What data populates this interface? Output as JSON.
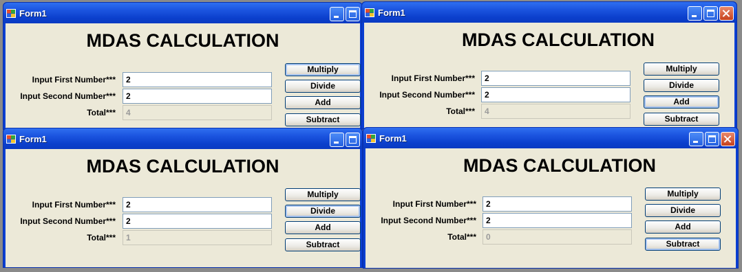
{
  "windows": [
    {
      "title": "Form1",
      "heading": "MDAS CALCULATION",
      "first_label": "Input First Number***",
      "second_label": "Input Second Number***",
      "total_label": "Total***",
      "first_value": "2",
      "second_value": "2",
      "total_value": "4",
      "focused_button": "multiply",
      "buttons": {
        "multiply": "Multiply",
        "divide": "Divide",
        "add": "Add",
        "subtract": "Subtract"
      }
    },
    {
      "title": "Form1",
      "heading": "MDAS CALCULATION",
      "first_label": "Input First Number***",
      "second_label": "Input Second Number***",
      "total_label": "Total***",
      "first_value": "2",
      "second_value": "2",
      "total_value": "4",
      "focused_button": "add",
      "buttons": {
        "multiply": "Multiply",
        "divide": "Divide",
        "add": "Add",
        "subtract": "Subtract"
      }
    },
    {
      "title": "Form1",
      "heading": "MDAS CALCULATION",
      "first_label": "Input First Number***",
      "second_label": "Input Second Number***",
      "total_label": "Total***",
      "first_value": "2",
      "second_value": "2",
      "total_value": "1",
      "focused_button": "divide",
      "buttons": {
        "multiply": "Multiply",
        "divide": "Divide",
        "add": "Add",
        "subtract": "Subtract"
      }
    },
    {
      "title": "Form1",
      "heading": "MDAS CALCULATION",
      "first_label": "Input First Number***",
      "second_label": "Input Second Number***",
      "total_label": "Total***",
      "first_value": "2",
      "second_value": "2",
      "total_value": "0",
      "focused_button": "subtract",
      "buttons": {
        "multiply": "Multiply",
        "divide": "Divide",
        "add": "Add",
        "subtract": "Subtract"
      }
    }
  ],
  "icons": {
    "app": "form-app-icon",
    "minimize": "minimize-icon",
    "maximize": "maximize-icon",
    "close": "close-icon"
  },
  "colors": {
    "titlebar_blue": "#0a3fd2",
    "client_bg": "#ece9d8",
    "close_red": "#c6401c"
  }
}
